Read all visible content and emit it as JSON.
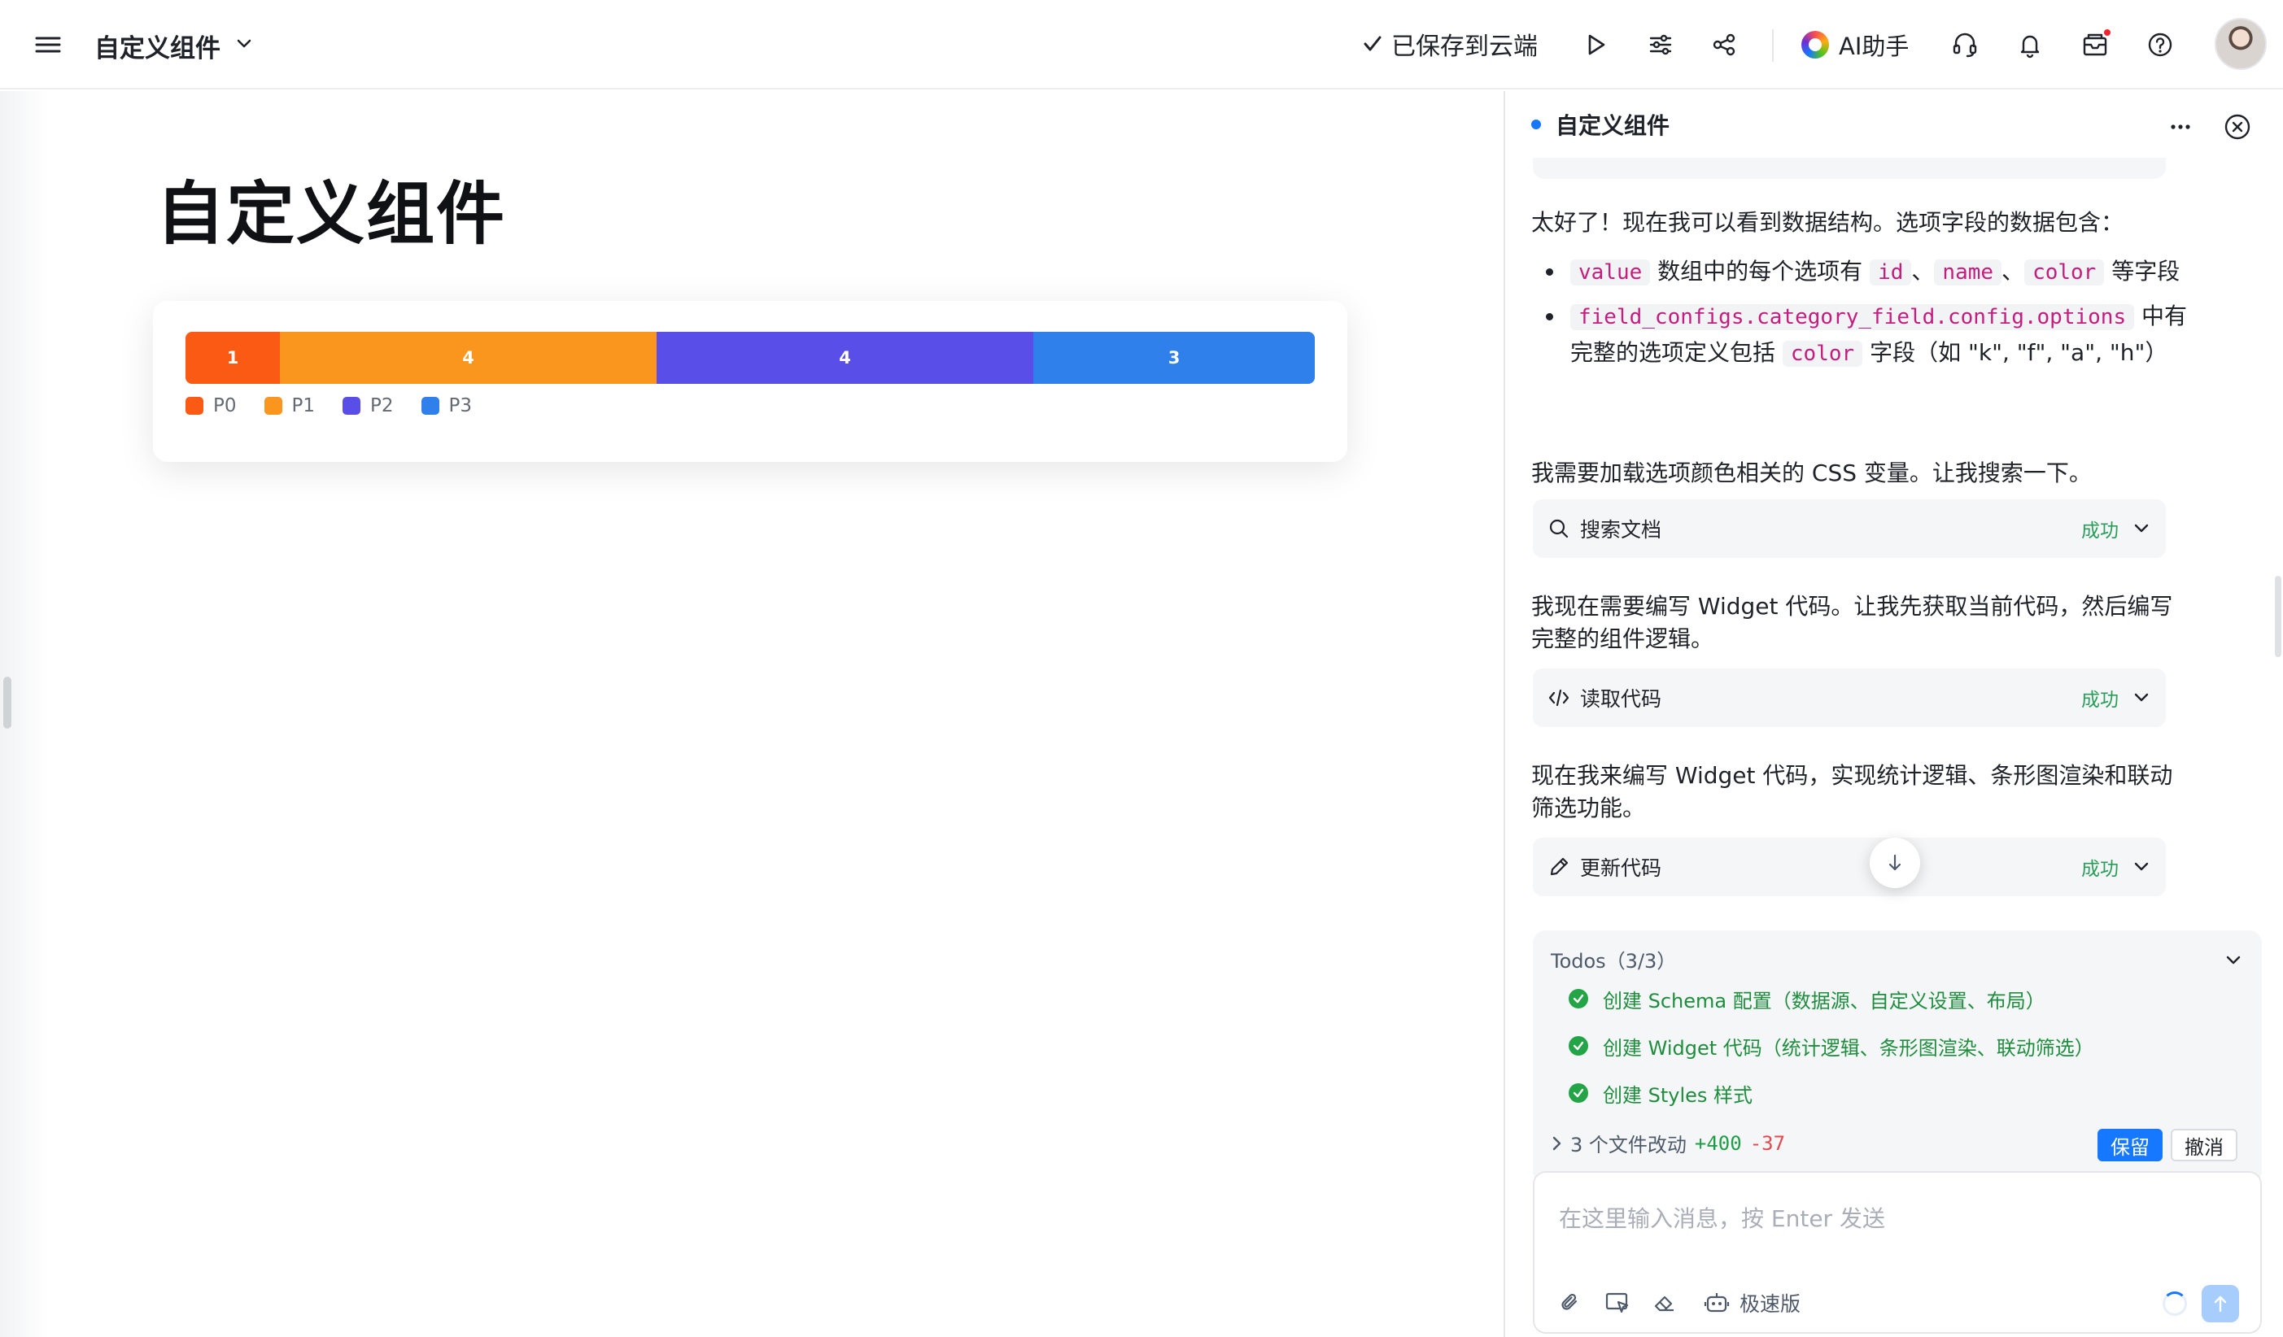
{
  "topbar": {
    "title": "自定义组件",
    "saved_status": "已保存到云端",
    "ai_label": "AI助手",
    "icons": [
      "menu-icon",
      "chevron-down-icon",
      "check-icon",
      "play-icon",
      "sliders-icon",
      "share-icon",
      "headset-icon",
      "bell-icon",
      "inbox-icon",
      "help-icon"
    ]
  },
  "page": {
    "title": "自定义组件"
  },
  "chart_data": {
    "type": "bar",
    "orientation": "horizontal-stacked",
    "categories": [
      "P0",
      "P1",
      "P2",
      "P3"
    ],
    "values": [
      1,
      4,
      4,
      3
    ],
    "colors": [
      "#fa5a14",
      "#fa961e",
      "#594fe8",
      "#2f80eb"
    ],
    "legend": "bottom-left"
  },
  "panel": {
    "title": "自定义组件",
    "msg1": "太好了！现在我可以看到数据结构。选项字段的数据包含：",
    "bullet1": {
      "code_value": "value",
      "text_a": " 数组中的每个选项有 ",
      "code_id": "id",
      "sep1": "、",
      "code_name": "name",
      "sep2": "、",
      "code_color": "color",
      "text_b": " 等字段"
    },
    "bullet2": {
      "code_path": "field_configs.category_field.config.options",
      "text_a": " 中有完整的选项定义包括 ",
      "code_color": "color",
      "text_b": " 字段（如 \"k\", \"f\", \"a\", \"h\"）"
    },
    "msg2": "我需要加载选项颜色相关的 CSS 变量。让我搜索一下。",
    "tool1": {
      "label": "搜索文档",
      "status": "成功"
    },
    "msg3": "我现在需要编写 Widget 代码。让我先获取当前代码，然后编写完整的组件逻辑。",
    "tool2": {
      "label": "读取代码",
      "status": "成功"
    },
    "msg4": "现在我来编写 Widget 代码，实现统计逻辑、条形图渲染和联动筛选功能。",
    "tool3": {
      "label": "更新代码",
      "status": "成功"
    },
    "todos": {
      "title": "Todos（3/3）",
      "items": [
        "创建 Schema 配置（数据源、自定义设置、布局）",
        "创建 Widget 代码（统计逻辑、条形图渲染、联动筛选）",
        "创建 Styles 样式"
      ],
      "changes_label": "3 个文件改动",
      "additions": "+400",
      "deletions": "-37",
      "keep_label": "保留",
      "undo_label": "撤消"
    },
    "composer": {
      "placeholder": "在这里输入消息，按 Enter 发送",
      "mode_label": "极速版"
    }
  }
}
